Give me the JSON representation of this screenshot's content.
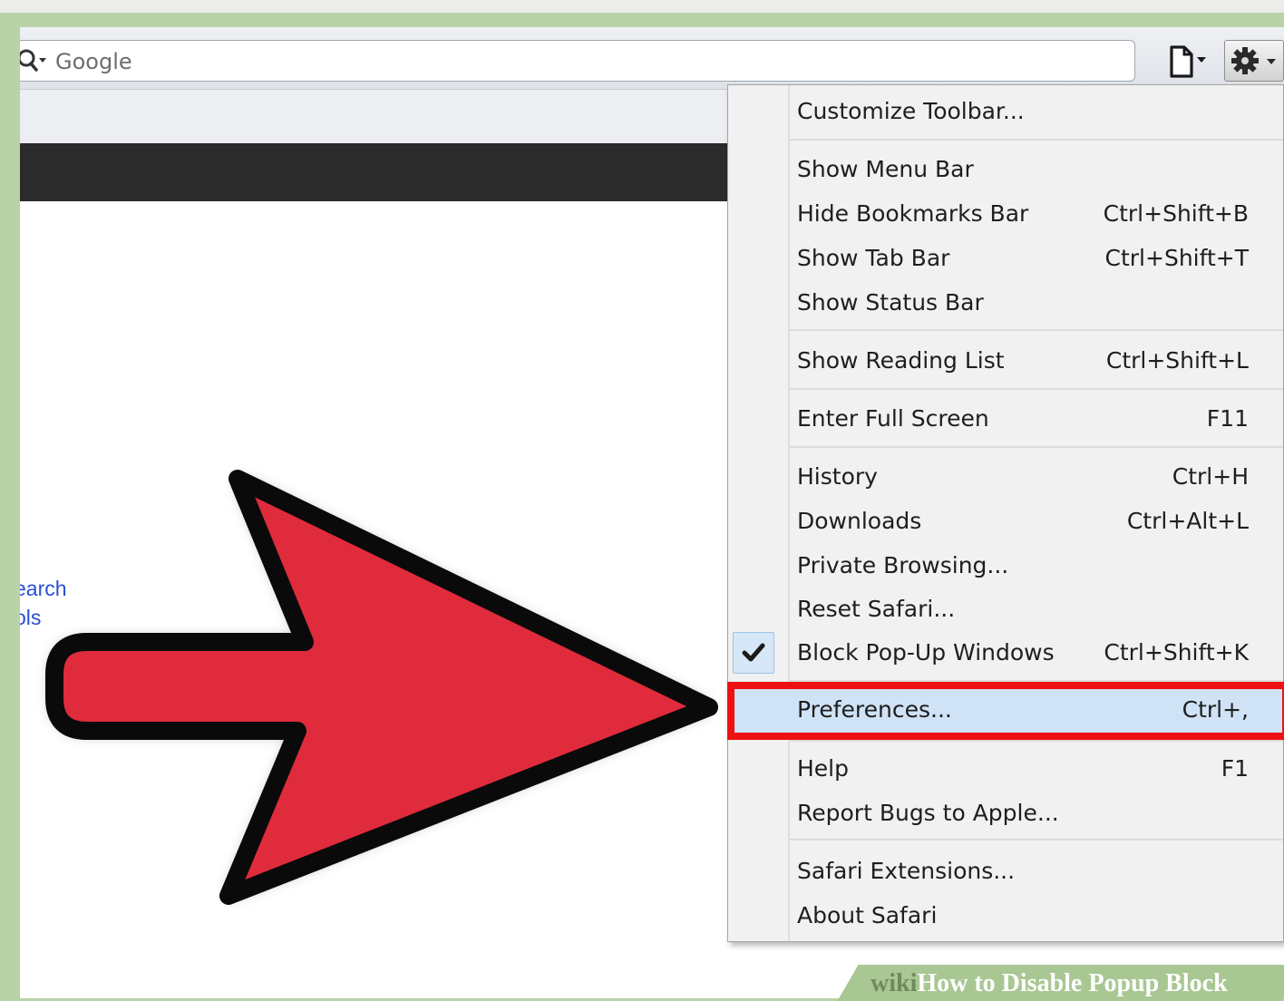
{
  "browser": {
    "search": {
      "placeholder": "Google"
    }
  },
  "page": {
    "links": [
      "earch",
      "ols"
    ]
  },
  "menu": {
    "items": [
      {
        "label": "Customize Toolbar...",
        "shortcut": ""
      },
      {
        "label": "Show Menu Bar",
        "shortcut": ""
      },
      {
        "label": "Hide Bookmarks Bar",
        "shortcut": "Ctrl+Shift+B"
      },
      {
        "label": "Show Tab Bar",
        "shortcut": "Ctrl+Shift+T"
      },
      {
        "label": "Show Status Bar",
        "shortcut": ""
      },
      {
        "label": "Show Reading List",
        "shortcut": "Ctrl+Shift+L"
      },
      {
        "label": "Enter Full Screen",
        "shortcut": "F11"
      },
      {
        "label": "History",
        "shortcut": "Ctrl+H"
      },
      {
        "label": "Downloads",
        "shortcut": "Ctrl+Alt+L"
      },
      {
        "label": "Private Browsing...",
        "shortcut": ""
      },
      {
        "label": "Reset Safari...",
        "shortcut": ""
      },
      {
        "label": "Block Pop-Up Windows",
        "shortcut": "Ctrl+Shift+K",
        "checked": true
      },
      {
        "label": "Preferences...",
        "shortcut": "Ctrl+,",
        "highlighted": true
      },
      {
        "label": "Help",
        "shortcut": "F1"
      },
      {
        "label": "Report Bugs to Apple...",
        "shortcut": ""
      },
      {
        "label": "Safari Extensions...",
        "shortcut": ""
      },
      {
        "label": "About Safari",
        "shortcut": ""
      }
    ]
  },
  "watermark": {
    "brand": "wiki",
    "title": "How to Disable Popup Block"
  },
  "colors": {
    "frame": "#b9d2a8",
    "arrow_fill": "#e02b3c",
    "highlight_border": "#ee1111",
    "link": "#2a4fd6"
  },
  "icons": {
    "search": "magnifier-icon",
    "page_menu": "page-icon",
    "settings": "gear-icon",
    "check": "checkmark-icon"
  }
}
